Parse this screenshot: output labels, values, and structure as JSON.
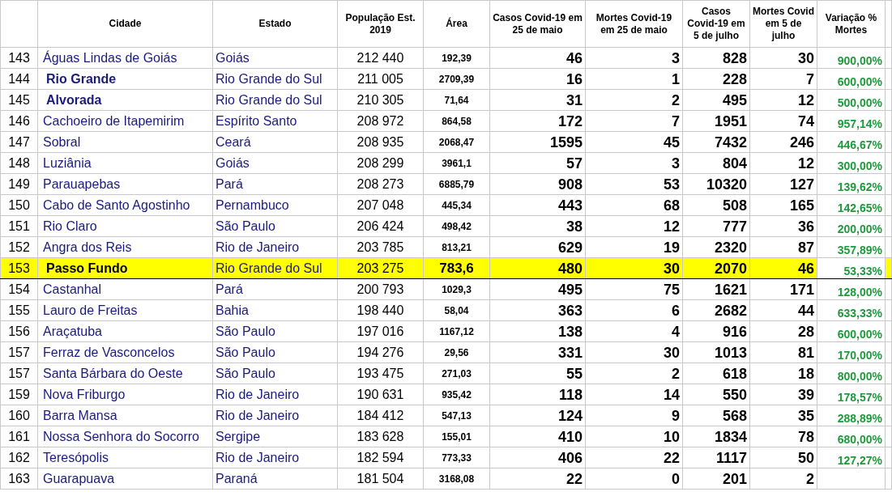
{
  "table": {
    "columns": [
      "Cidade",
      "Estado",
      "População Est. 2019",
      "Área",
      "Casos Covid-19 em 25 de maio",
      "Mortes Covid-19 em 25 de maio",
      "Casos Covid-19 em 5 de julho",
      "Mortes Covid em 5 de julho",
      "Variação % Mortes"
    ],
    "rows": [
      {
        "rank": "143",
        "city": "Águas Lindas de Goiás",
        "state": "Goiás",
        "population": "212 440",
        "area": "192,39",
        "cases_may": "46",
        "deaths_may": "3",
        "cases_jul": "828",
        "deaths_jul": "30",
        "variation": "900,00%",
        "bold": false,
        "highlighted": false
      },
      {
        "rank": "144",
        "city": "Rio Grande",
        "state": "Rio Grande do Sul",
        "population": "211 005",
        "area": "2709,39",
        "cases_may": "16",
        "deaths_may": "1",
        "cases_jul": "228",
        "deaths_jul": "7",
        "variation": "600,00%",
        "bold": true,
        "highlighted": false
      },
      {
        "rank": "145",
        "city": "Alvorada",
        "state": "Rio Grande do Sul",
        "population": "210 305",
        "area": "71,64",
        "cases_may": "31",
        "deaths_may": "2",
        "cases_jul": "495",
        "deaths_jul": "12",
        "variation": "500,00%",
        "bold": true,
        "highlighted": false
      },
      {
        "rank": "146",
        "city": "Cachoeiro de Itapemirim",
        "state": "Espírito Santo",
        "population": "208 972",
        "area": "864,58",
        "cases_may": "172",
        "deaths_may": "7",
        "cases_jul": "1951",
        "deaths_jul": "74",
        "variation": "957,14%",
        "bold": false,
        "highlighted": false
      },
      {
        "rank": "147",
        "city": "Sobral",
        "state": "Ceará",
        "population": "208 935",
        "area": "2068,47",
        "cases_may": "1595",
        "deaths_may": "45",
        "cases_jul": "7432",
        "deaths_jul": "246",
        "variation": "446,67%",
        "bold": false,
        "highlighted": false
      },
      {
        "rank": "148",
        "city": "Luziânia",
        "state": "Goiás",
        "population": "208 299",
        "area": "3961,1",
        "cases_may": "57",
        "deaths_may": "3",
        "cases_jul": "804",
        "deaths_jul": "12",
        "variation": "300,00%",
        "bold": false,
        "highlighted": false
      },
      {
        "rank": "149",
        "city": "Parauapebas",
        "state": "Pará",
        "population": "208 273",
        "area": "6885,79",
        "cases_may": "908",
        "deaths_may": "53",
        "cases_jul": "10320",
        "deaths_jul": "127",
        "variation": "139,62%",
        "bold": false,
        "highlighted": false
      },
      {
        "rank": "150",
        "city": "Cabo de Santo Agostinho",
        "state": "Pernambuco",
        "population": "207 048",
        "area": "445,34",
        "cases_may": "443",
        "deaths_may": "68",
        "cases_jul": "508",
        "deaths_jul": "165",
        "variation": "142,65%",
        "bold": false,
        "highlighted": false
      },
      {
        "rank": "151",
        "city": "Rio Claro",
        "state": "São Paulo",
        "population": "206 424",
        "area": "498,42",
        "cases_may": "38",
        "deaths_may": "12",
        "cases_jul": "777",
        "deaths_jul": "36",
        "variation": "200,00%",
        "bold": false,
        "highlighted": false
      },
      {
        "rank": "152",
        "city": "Angra dos Reis",
        "state": "Rio de Janeiro",
        "population": "203 785",
        "area": "813,21",
        "cases_may": "629",
        "deaths_may": "19",
        "cases_jul": "2320",
        "deaths_jul": "87",
        "variation": "357,89%",
        "bold": false,
        "highlighted": false
      },
      {
        "rank": "153",
        "city": "Passo Fundo",
        "state": "Rio Grande do Sul",
        "population": "203 275",
        "area": "783,6",
        "cases_may": "480",
        "deaths_may": "30",
        "cases_jul": "2070",
        "deaths_jul": "46",
        "variation": "53,33%",
        "bold": true,
        "highlighted": true
      },
      {
        "rank": "154",
        "city": "Castanhal",
        "state": "Pará",
        "population": "200 793",
        "area": "1029,3",
        "cases_may": "495",
        "deaths_may": "75",
        "cases_jul": "1621",
        "deaths_jul": "171",
        "variation": "128,00%",
        "bold": false,
        "highlighted": false
      },
      {
        "rank": "155",
        "city": "Lauro de Freitas",
        "state": "Bahia",
        "population": "198 440",
        "area": "58,04",
        "cases_may": "363",
        "deaths_may": "6",
        "cases_jul": "2682",
        "deaths_jul": "44",
        "variation": "633,33%",
        "bold": false,
        "highlighted": false
      },
      {
        "rank": "156",
        "city": "Araçatuba",
        "state": "São Paulo",
        "population": "197 016",
        "area": "1167,12",
        "cases_may": "138",
        "deaths_may": "4",
        "cases_jul": "916",
        "deaths_jul": "28",
        "variation": "600,00%",
        "bold": false,
        "highlighted": false
      },
      {
        "rank": "157",
        "city": "Ferraz de Vasconcelos",
        "state": "São Paulo",
        "population": "194 276",
        "area": "29,56",
        "cases_may": "331",
        "deaths_may": "30",
        "cases_jul": "1013",
        "deaths_jul": "81",
        "variation": "170,00%",
        "bold": false,
        "highlighted": false
      },
      {
        "rank": "157",
        "city": "Santa Bárbara do Oeste",
        "state": "São Paulo",
        "population": "193 475",
        "area": "271,03",
        "cases_may": "55",
        "deaths_may": "2",
        "cases_jul": "618",
        "deaths_jul": "18",
        "variation": "800,00%",
        "bold": false,
        "highlighted": false
      },
      {
        "rank": "159",
        "city": "Nova Friburgo",
        "state": "Rio de Janeiro",
        "population": "190 631",
        "area": "935,42",
        "cases_may": "118",
        "deaths_may": "14",
        "cases_jul": "550",
        "deaths_jul": "39",
        "variation": "178,57%",
        "bold": false,
        "highlighted": false
      },
      {
        "rank": "160",
        "city": "Barra Mansa",
        "state": "Rio de Janeiro",
        "population": "184 412",
        "area": "547,13",
        "cases_may": "124",
        "deaths_may": "9",
        "cases_jul": "568",
        "deaths_jul": "35",
        "variation": "288,89%",
        "bold": false,
        "highlighted": false
      },
      {
        "rank": "161",
        "city": "Nossa Senhora do Socorro",
        "state": "Sergipe",
        "population": "183 628",
        "area": "155,01",
        "cases_may": "410",
        "deaths_may": "10",
        "cases_jul": "1834",
        "deaths_jul": "78",
        "variation": "680,00%",
        "bold": false,
        "highlighted": false
      },
      {
        "rank": "162",
        "city": "Teresópolis",
        "state": "Rio de Janeiro",
        "population": "182 594",
        "area": "773,33",
        "cases_may": "406",
        "deaths_may": "22",
        "cases_jul": "1117",
        "deaths_jul": "50",
        "variation": "127,27%",
        "bold": false,
        "highlighted": false
      },
      {
        "rank": "163",
        "city": "Guarapuava",
        "state": "Paraná",
        "population": "181 504",
        "area": "3168,08",
        "cases_may": "22",
        "deaths_may": "0",
        "cases_jul": "201",
        "deaths_jul": "2",
        "bold": false,
        "highlighted": false
      }
    ]
  }
}
